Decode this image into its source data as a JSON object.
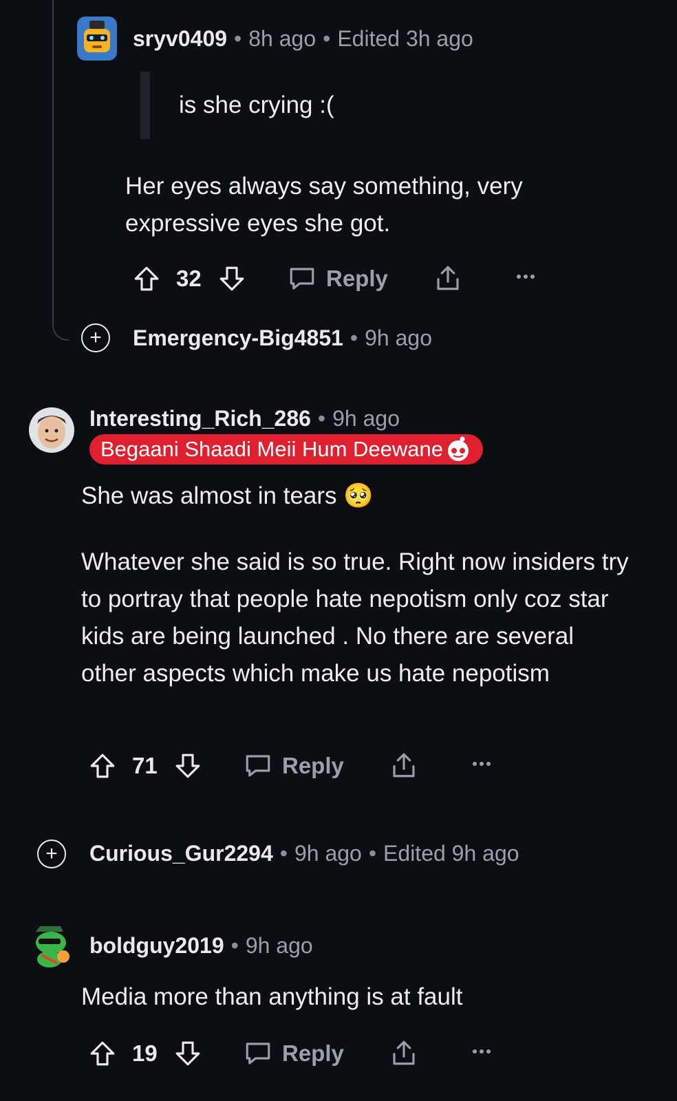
{
  "comments": [
    {
      "username": "sryv0409",
      "time": "8h ago",
      "edited": "Edited 3h ago",
      "quote": "is she crying :(",
      "body": "Her eyes always say something, very expressive eyes she got.",
      "votes": "32",
      "reply_label": "Reply",
      "avatar_icon": "robot-snoo-avatar-icon"
    },
    {
      "username": "Emergency-Big4851",
      "time": "9h ago",
      "collapsed": true
    },
    {
      "username": "Interesting_Rich_286",
      "time": "9h ago",
      "flair": "Begaani Shaadi Meii Hum Deewane",
      "body_line1": "She was almost in tears",
      "body_emoji": "🥺",
      "body_para2": "Whatever she said is so true. Right now insiders try to portray that people hate nepotism only coz star kids are being launched . No there are several other aspects which make us hate nepotism",
      "votes": "71",
      "reply_label": "Reply",
      "avatar_icon": "user-photo-avatar"
    },
    {
      "username": "Curious_Gur2294",
      "time": "9h ago",
      "edited": "Edited 9h ago",
      "collapsed": true
    },
    {
      "username": "boldguy2019",
      "time": "9h ago",
      "body": "Media more than anything is at fault",
      "votes": "19",
      "reply_label": "Reply",
      "avatar_icon": "green-snoo-avatar-icon"
    }
  ],
  "colors": {
    "background": "#0b0e13",
    "text": "#e8eaed",
    "muted": "#9aa0a8",
    "flair_bg": "#e0202f",
    "thread_line": "#343a44"
  }
}
